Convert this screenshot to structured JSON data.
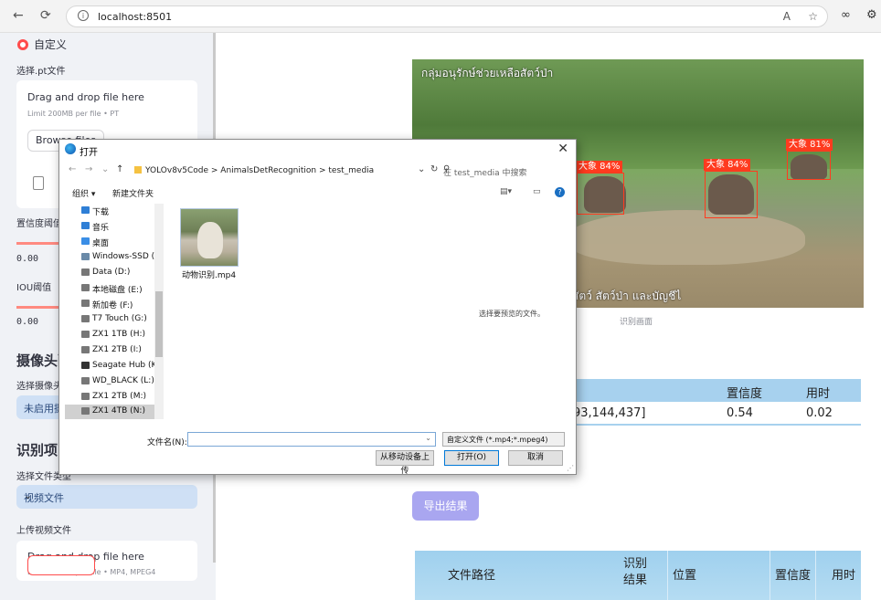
{
  "browser": {
    "url": "localhost:8501",
    "back_icon": "←",
    "reload_icon": "⟳",
    "read_icon": "A",
    "fav_icon": "☆",
    "ext1_icon": "∞",
    "ext2_icon": "⚙"
  },
  "sidebar": {
    "radio_label": "自定义",
    "pt_label": "选择.pt文件",
    "drop1_title": "Drag and drop file here",
    "drop1_limit": "Limit 200MB per file • PT",
    "browse1": "Browse files",
    "conf_label": "置信度阈值",
    "conf_value": "0.00",
    "iou_label": "IOU阈值",
    "iou_value": "0.00",
    "cam_section": "摄像头配置",
    "cam_label": "选择摄像头",
    "cam_select": "未启用摄像头",
    "rec_section": "识别项目设置",
    "filetype_label": "选择文件类型",
    "filetype_select": "视频文件",
    "upload_label": "上传视频文件",
    "drop2_title": "Drag and drop file here",
    "drop2_limit": "Limit 200MB per file • MP4, MPEG4",
    "browse2": "Browse files"
  },
  "main": {
    "video_caption_top": "กลุ่มอนุรักษ์ช่วยเหลือสัตว์ป่า",
    "video_caption_bottom": "สัตว์ สัตว์ป่า และบัญชีไ",
    "detections": [
      {
        "label": "大象 81%"
      },
      {
        "label": "大象 84%"
      },
      {
        "label": "大象 84%"
      }
    ],
    "image_caption": "识别画面",
    "table1": {
      "headers": [
        "置信度",
        "用时"
      ],
      "row": [
        "93,144,437]",
        "0.54",
        "0.02"
      ]
    },
    "export_button": "导出结果",
    "table2": {
      "headers": [
        "文件路径",
        "识别结果",
        "位置",
        "置信度",
        "用时"
      ]
    }
  },
  "dialog": {
    "title": "打开",
    "close_icon": "✕",
    "path": [
      "YOLOv8v5Code",
      "AnimalsDetRecognition",
      "test_media"
    ],
    "search_placeholder": "在 test_media 中搜索",
    "organize": "组织 ▾",
    "new_folder": "新建文件夹",
    "nav_items": [
      {
        "label": "下载",
        "color": "#2f7fd6"
      },
      {
        "label": "音乐",
        "color": "#2f7fd6"
      },
      {
        "label": "桌面",
        "color": "#3a8ee6"
      },
      {
        "label": "Windows-SSD (C",
        "color": "#6a8aa8"
      },
      {
        "label": "Data (D:)",
        "color": "#777777"
      },
      {
        "label": "本地磁盘 (E:)",
        "color": "#777777"
      },
      {
        "label": "新加卷 (F:)",
        "color": "#777777"
      },
      {
        "label": "T7 Touch (G:)",
        "color": "#777777"
      },
      {
        "label": "ZX1 1TB (H:)",
        "color": "#777777"
      },
      {
        "label": "ZX1 2TB (I:)",
        "color": "#777777"
      },
      {
        "label": "Seagate Hub (K:",
        "color": "#333333"
      },
      {
        "label": "WD_BLACK (L:)",
        "color": "#777777"
      },
      {
        "label": "ZX1 2TB (M:)",
        "color": "#777777"
      },
      {
        "label": "ZX1 4TB (N:)",
        "color": "#777777"
      }
    ],
    "file_name": "动物识别.mp4",
    "preview_hint": "选择要预览的文件。",
    "filename_label": "文件名(N):",
    "filename_value": "",
    "filetype": "自定义文件 (*.mp4;*.mpeg4)",
    "btn_mobile": "从移动设备上传",
    "btn_open": "打开(O)",
    "btn_cancel": "取消"
  }
}
